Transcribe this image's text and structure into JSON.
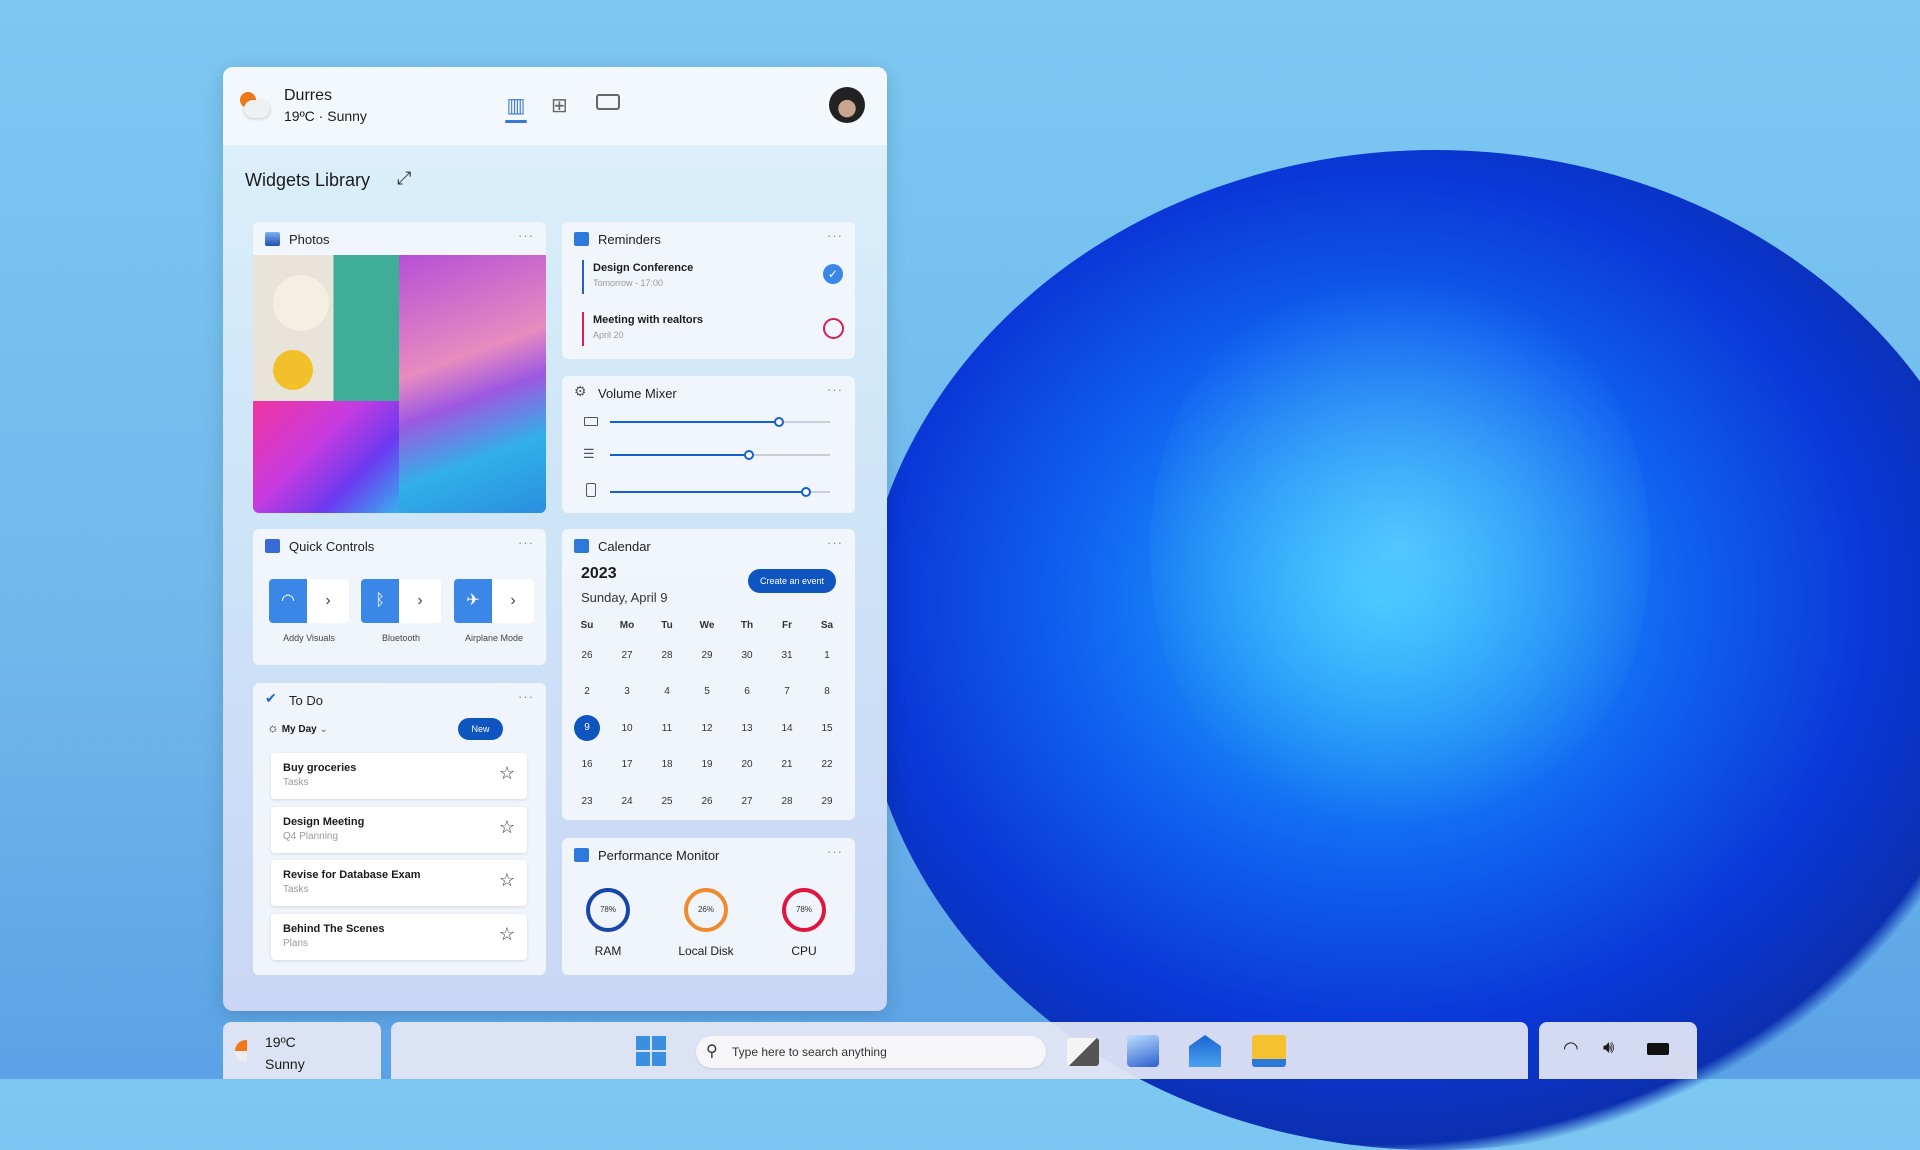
{
  "header": {
    "city": "Durres",
    "weather": "19ºC · Sunny",
    "tabs": [
      "library-icon",
      "widgets-icon",
      "video-icon"
    ]
  },
  "library": {
    "title": "Widgets Library"
  },
  "photos": {
    "title": "Photos"
  },
  "reminders": {
    "title": "Reminders",
    "items": [
      {
        "title": "Design Conference",
        "sub": "Tomorrow - 17:00",
        "done": true,
        "color": "#2d5fc4"
      },
      {
        "title": "Meeting with realtors",
        "sub": "April 20",
        "done": false,
        "color": "#d6204f"
      }
    ]
  },
  "volume": {
    "title": "Volume Mixer",
    "levels": [
      77,
      63,
      89
    ]
  },
  "quick": {
    "title": "Quick Controls",
    "items": [
      {
        "label": "Addy Visuals",
        "icon": "wifi-icon"
      },
      {
        "label": "Bluetooth",
        "icon": "bluetooth-icon"
      },
      {
        "label": "Airplane Mode",
        "icon": "airplane-icon"
      }
    ]
  },
  "calendar": {
    "title": "Calendar",
    "year": "2023",
    "date": "Sunday, April 9",
    "create": "Create an event",
    "days": [
      "Su",
      "Mo",
      "Tu",
      "We",
      "Th",
      "Fr",
      "Sa"
    ],
    "weeks": [
      [
        "26",
        "27",
        "28",
        "29",
        "30",
        "31",
        "1"
      ],
      [
        "2",
        "3",
        "4",
        "5",
        "6",
        "7",
        "8"
      ],
      [
        "9",
        "10",
        "11",
        "12",
        "13",
        "14",
        "15"
      ],
      [
        "16",
        "17",
        "18",
        "19",
        "20",
        "21",
        "22"
      ],
      [
        "23",
        "24",
        "25",
        "26",
        "27",
        "28",
        "29"
      ]
    ],
    "selected": "9"
  },
  "todo": {
    "title": "To Do",
    "list": "My Day",
    "new": "New",
    "items": [
      {
        "title": "Buy groceries",
        "sub": "Tasks"
      },
      {
        "title": "Design Meeting",
        "sub": "Q4 Planning"
      },
      {
        "title": "Revise for Database Exam",
        "sub": "Tasks"
      },
      {
        "title": "Behind The Scenes",
        "sub": "Plans"
      }
    ]
  },
  "perf": {
    "title": "Performance Monitor",
    "items": [
      {
        "value": "78%",
        "label": "RAM",
        "color": "#1646a8"
      },
      {
        "value": "26%",
        "label": "Local Disk",
        "color": "#f08a2c"
      },
      {
        "value": "78%",
        "label": "CPU",
        "color": "#e0153f"
      }
    ]
  },
  "taskbar": {
    "temp": "19ºC",
    "cond": "Sunny",
    "search_placeholder": "Type here to search anything"
  }
}
